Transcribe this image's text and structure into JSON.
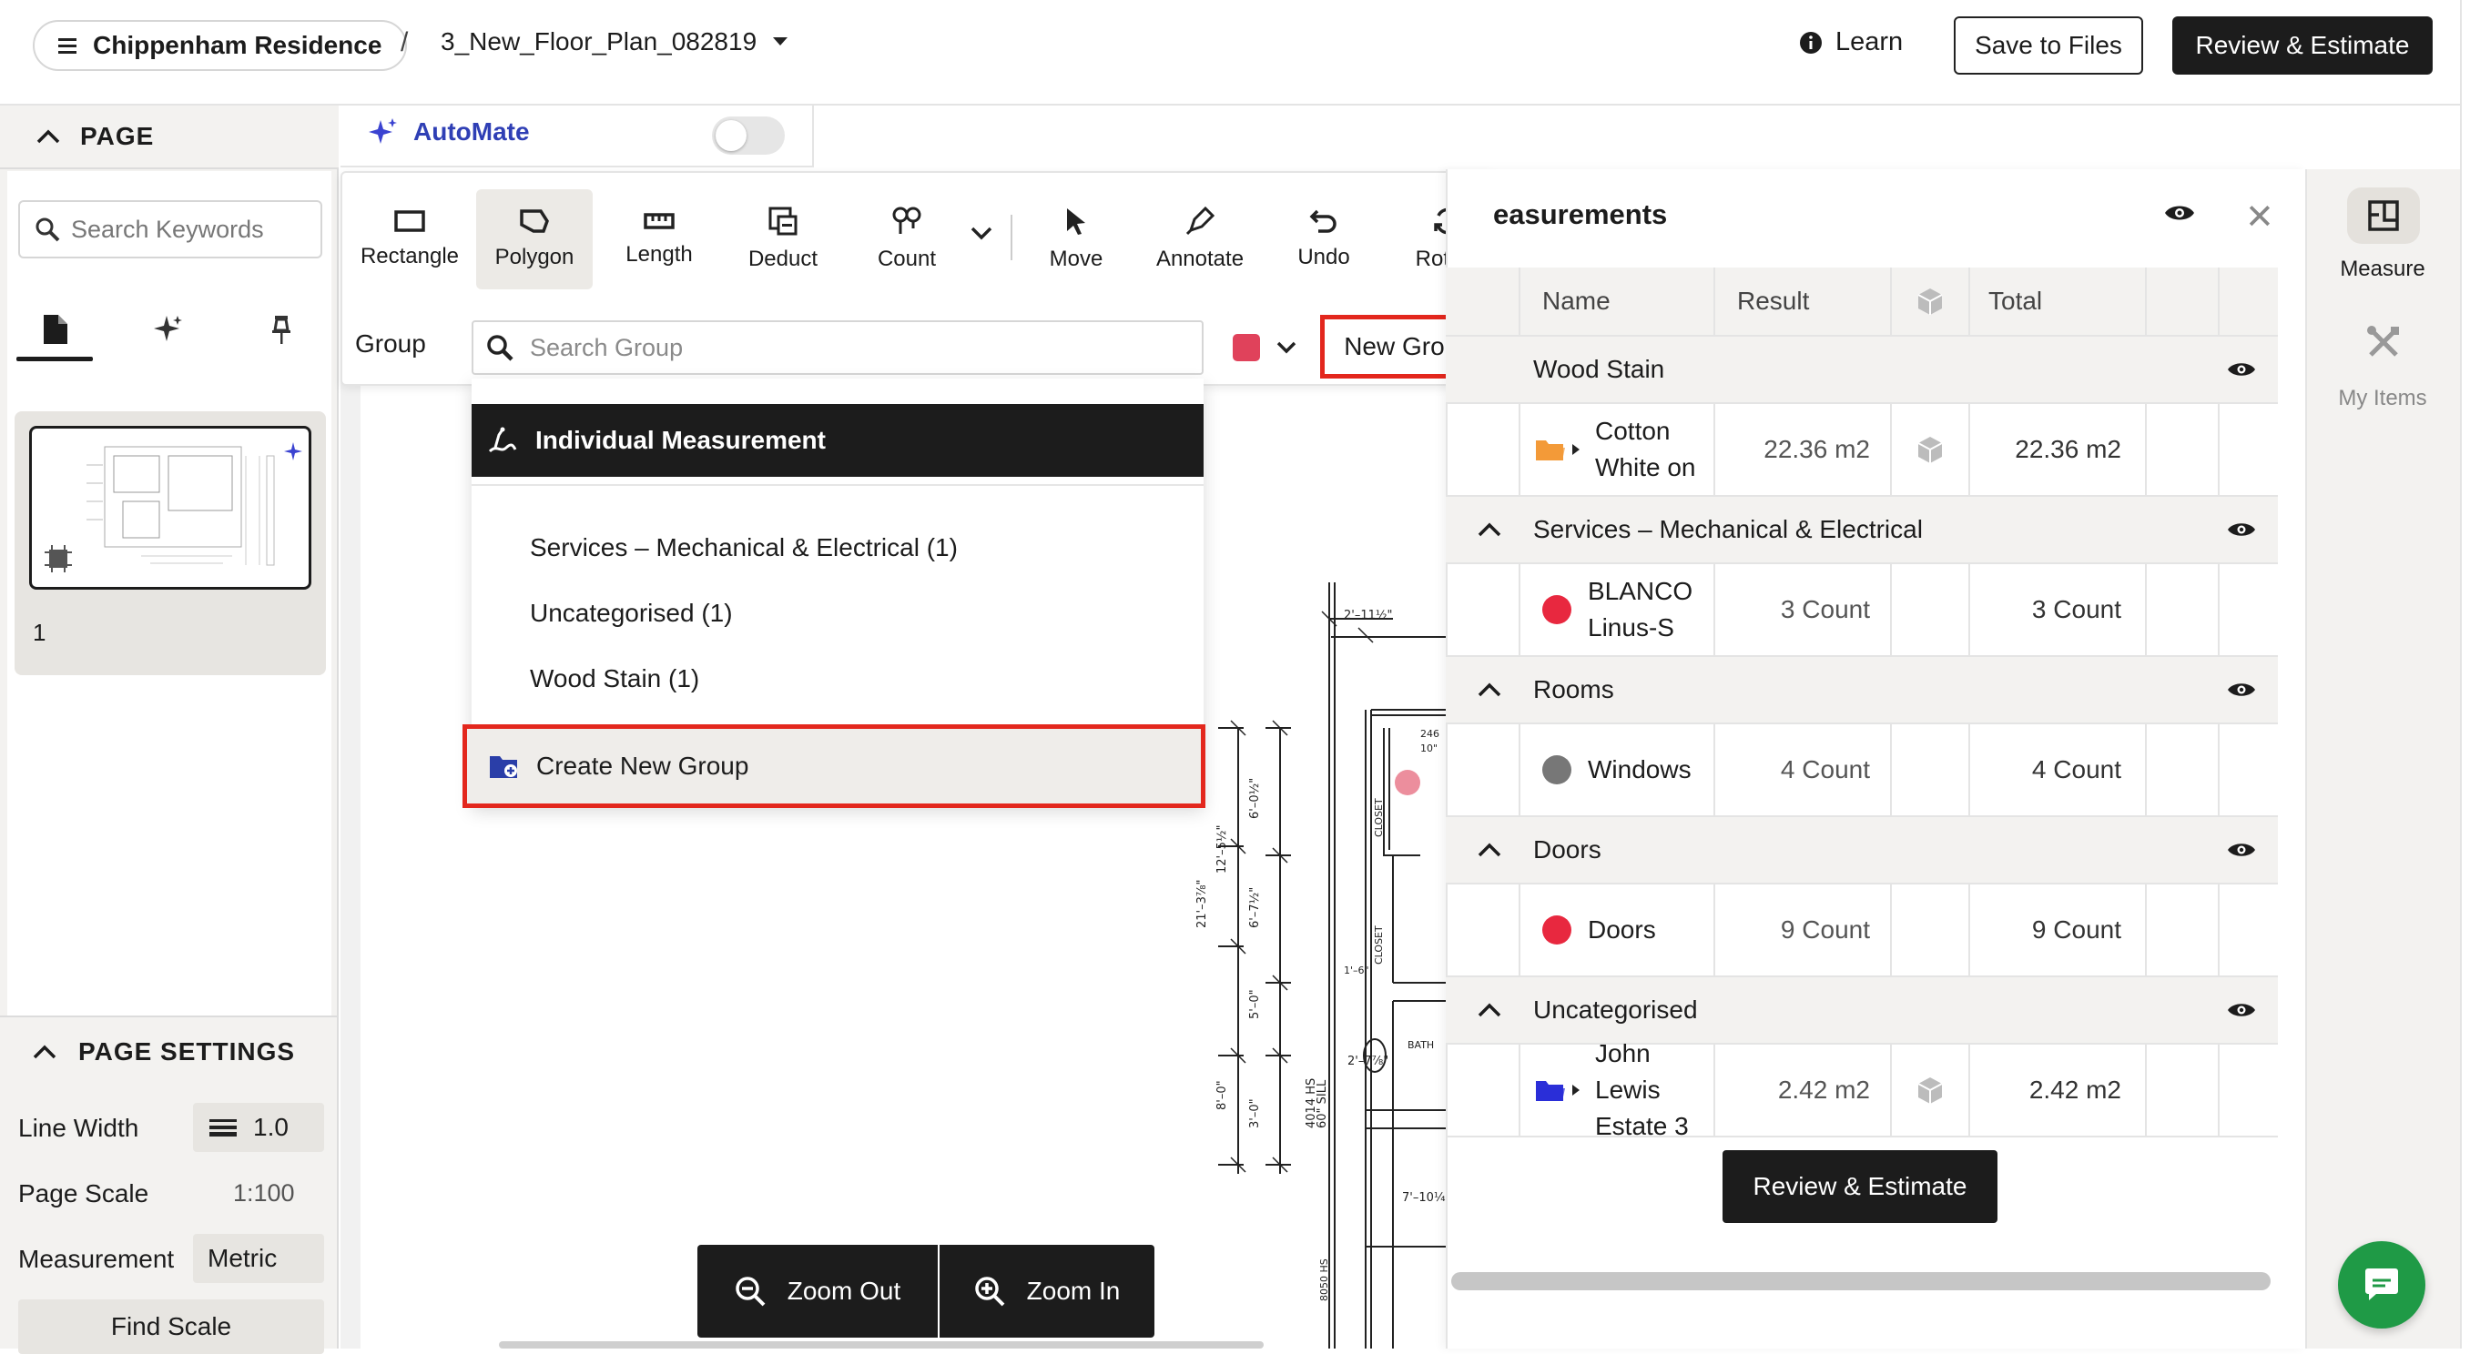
{
  "header": {
    "project": "Chippenham Residence",
    "separator": "/",
    "file": "3_New_Floor_Plan_082819",
    "learn": "Learn",
    "save": "Save to Files",
    "review": "Review & Estimate"
  },
  "left": {
    "page_title": "PAGE",
    "search_placeholder": "Search Keywords",
    "page_number": "1",
    "settings_title": "PAGE SETTINGS",
    "line_width_label": "Line Width",
    "line_width_value": "1.0",
    "page_scale_label": "Page Scale",
    "page_scale_value": "1:100",
    "measurement_label": "Measurement",
    "measurement_value": "Metric",
    "find_scale": "Find Scale"
  },
  "automate": {
    "label": "AutoMate",
    "enabled": false
  },
  "toolbar": {
    "tools": [
      "Rectangle",
      "Polygon",
      "Length",
      "Deduct",
      "Count",
      "Move",
      "Annotate",
      "Undo",
      "Rotate"
    ],
    "active": "Polygon",
    "group_label": "Group",
    "search_placeholder": "Search Group",
    "color": "#e0425b",
    "new_group": "New Group"
  },
  "dropdown": {
    "individual": "Individual Measurement",
    "items": [
      "Services – Mechanical & Electrical (1)",
      "Uncategorised (1)",
      "Wood Stain (1)"
    ],
    "create": "Create New Group"
  },
  "zoom": {
    "out": "Zoom Out",
    "in": "Zoom In"
  },
  "measurements": {
    "title": "easurements",
    "columns": {
      "name": "Name",
      "result": "Result",
      "total": "Total"
    },
    "groups": [
      {
        "name": "Wood Stain",
        "row": {
          "line1": "Cotton",
          "line2": "White on",
          "result": "22.36 m2",
          "total": "22.36 m2",
          "icon": "folder-orange",
          "color": "#f39a38"
        }
      },
      {
        "name": "Services – Mechanical & Electrical",
        "row": {
          "line1": "BLANCO",
          "line2": "Linus-S",
          "result": "3 Count",
          "total": "3 Count",
          "icon": "dot",
          "color": "#e8283f"
        }
      },
      {
        "name": "Rooms",
        "row": {
          "line1": "Windows",
          "line2": "",
          "result": "4 Count",
          "total": "4 Count",
          "icon": "dot",
          "color": "#777777"
        }
      },
      {
        "name": "Doors",
        "row": {
          "line1": "Doors",
          "line2": "",
          "result": "9 Count",
          "total": "9 Count",
          "icon": "dot",
          "color": "#e8283f"
        }
      },
      {
        "name": "Uncategorised",
        "row": {
          "line1": "John Lewis",
          "line2": "Estate 3",
          "result": "2.42 m2",
          "total": "2.42 m2",
          "icon": "folder-blue",
          "color": "#2b2fd8"
        }
      }
    ],
    "review": "Review & Estimate"
  },
  "rail": {
    "measure": "Measure",
    "my_items": "My Items"
  }
}
